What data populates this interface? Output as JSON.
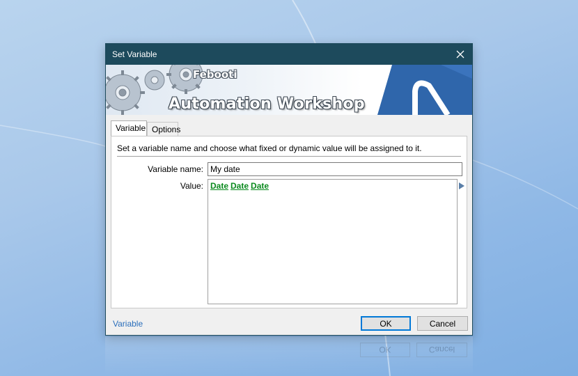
{
  "dialog": {
    "title": "Set Variable",
    "banner": {
      "brand_top": "Febooti",
      "brand_main": "Automation Workshop"
    },
    "tabs": [
      {
        "label": "Variable",
        "active": true
      },
      {
        "label": "Options",
        "active": false
      }
    ],
    "description": "Set a variable name and choose what fixed or dynamic value will be assigned to it.",
    "fields": {
      "name_label": "Variable name:",
      "name_value": "My date",
      "value_label": "Value:",
      "value_tokens": [
        "Date",
        "Date",
        "Date"
      ]
    },
    "footer": {
      "link": "Variable",
      "ok": "OK",
      "cancel": "Cancel"
    }
  },
  "colors": {
    "titlebar": "#1d4a5c",
    "token": "#0a8a1e",
    "link": "#2a6ebb",
    "logo_blue": "#2f66ab"
  }
}
